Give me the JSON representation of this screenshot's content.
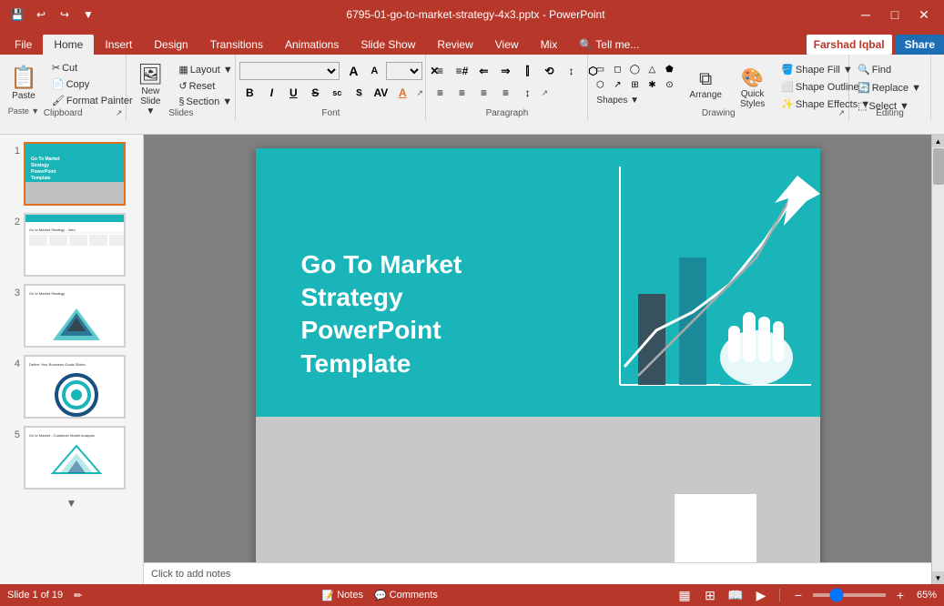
{
  "window": {
    "title": "6795-01-go-to-market-strategy-4x3.pptx - PowerPoint",
    "min_btn": "─",
    "max_btn": "□",
    "close_btn": "✕"
  },
  "qat": {
    "save": "💾",
    "undo": "↩",
    "redo": "↪",
    "customize": "▼"
  },
  "tabs": [
    "File",
    "Home",
    "Insert",
    "Design",
    "Transitions",
    "Animations",
    "Slide Show",
    "Review",
    "View",
    "Mix",
    "Tell me..."
  ],
  "active_tab": "Home",
  "ribbon": {
    "groups": {
      "clipboard": {
        "label": "Clipboard",
        "paste_label": "Paste",
        "buttons": [
          "Cut",
          "Copy",
          "Format Painter"
        ]
      },
      "slides": {
        "label": "Slides",
        "new_slide": "New\nSlide",
        "layout": "Layout",
        "reset": "Reset",
        "section": "Section"
      },
      "font": {
        "label": "Font",
        "font_name": "",
        "font_size": "",
        "bold": "B",
        "italic": "I",
        "underline": "U",
        "strikethrough": "S",
        "small_caps": "sc",
        "shadow": "S",
        "font_color": "A",
        "increase_size": "A↑",
        "decrease_size": "A↓",
        "clear": "✕",
        "dialog": "↗"
      },
      "paragraph": {
        "label": "Paragraph",
        "bullets": "≡",
        "numbered": "≡#",
        "decrease_indent": "⇐",
        "increase_indent": "⇒",
        "dialog": "↗"
      },
      "drawing": {
        "label": "Drawing",
        "shapes_label": "Shapes",
        "arrange_label": "Arrange",
        "quick_styles_label": "Quick\nStyles",
        "shape_fill": "Shape Fill",
        "shape_outline": "Shape Outline",
        "shape_effects": "Shape Effects",
        "fill_arrow": "▼",
        "outline_arrow": "▼",
        "effects_arrow": "▼"
      },
      "editing": {
        "label": "Editing",
        "find": "Find",
        "replace": "Replace",
        "select": "Select"
      }
    }
  },
  "slides": [
    {
      "num": 1,
      "active": true
    },
    {
      "num": 2,
      "active": false
    },
    {
      "num": 3,
      "active": false
    },
    {
      "num": 4,
      "active": false
    },
    {
      "num": 5,
      "active": false
    }
  ],
  "slide": {
    "title_line1": "Go To Market",
    "title_line2": "Strategy",
    "title_line3": "PowerPoint",
    "title_line4": "Template",
    "top_color": "#1ab5b8",
    "bottom_color": "#c8c8c8"
  },
  "status": {
    "slide_info": "Slide 1 of 19",
    "notes_label": "Notes",
    "comments_label": "Comments",
    "zoom_level": "65%"
  },
  "user": {
    "name": "Farshad Iqbal",
    "share": "Share"
  }
}
